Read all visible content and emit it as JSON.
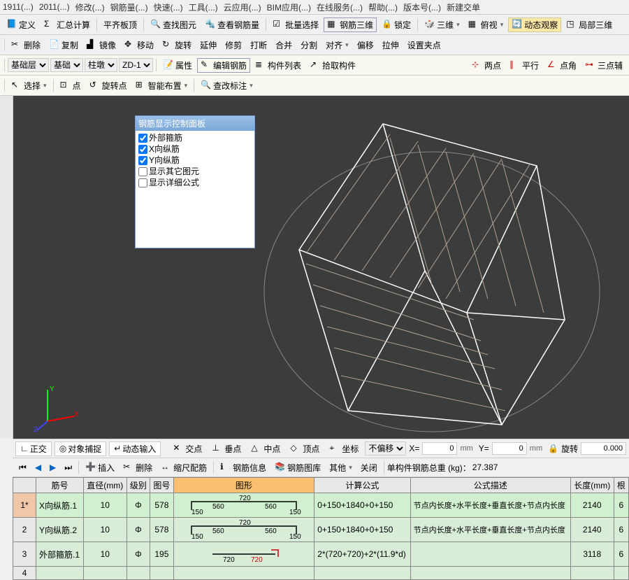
{
  "menubar": [
    "1911(...)",
    "2011(...)",
    "修改(...)",
    "钢筋量(...)",
    "快速(...)",
    "工具(...)",
    "云应用(...)",
    "BIM应用(...)",
    "在线服务(...)",
    "帮助(...)",
    "版本号(...)",
    "新建交单"
  ],
  "toolbar1": {
    "items": [
      "定义",
      "汇总计算",
      "平齐板顶",
      "查找图元",
      "查看钢筋量",
      "批量选择",
      "钢筋三维",
      "锁定"
    ],
    "group_3d": "三维",
    "view_top": "俯视",
    "dyn_view": "动态观察",
    "local_3d": "局部三维"
  },
  "toolbar2": {
    "items": [
      "删除",
      "复制",
      "镜像",
      "移动",
      "旋转",
      "延伸",
      "修剪",
      "打断",
      "合并",
      "分割",
      "对齐",
      "偏移",
      "拉伸",
      "设置夹点"
    ]
  },
  "toolbar3": {
    "layer_sel": "基础层",
    "categ_sel": "基础",
    "type_sel": "柱墩",
    "name_sel": "ZD-1",
    "attr": "属性",
    "edit_rebar": "编辑钢筋",
    "list": "构件列表",
    "pick": "拾取构件",
    "two_pt": "两点",
    "parallel": "平行",
    "pt_angle": "点角",
    "three_pt": "三点辅"
  },
  "toolbar4": {
    "select": "选择",
    "pt": "点",
    "rot_pt": "旋转点",
    "smart": "智能布置",
    "find_mark": "查改标注"
  },
  "panel": {
    "title": "钢筋显示控制面板",
    "items": [
      {
        "label": "外部箍筋",
        "checked": true
      },
      {
        "label": "X向纵筋",
        "checked": true
      },
      {
        "label": "Y向纵筋",
        "checked": true
      },
      {
        "label": "显示其它图元",
        "checked": false
      },
      {
        "label": "显示详细公式",
        "checked": false
      }
    ]
  },
  "status": {
    "ortho": "正交",
    "snap": "对象捕捉",
    "dynin": "动态输入",
    "cross": "交点",
    "perp": "垂点",
    "mid": "中点",
    "peak": "顶点",
    "coord": "坐标",
    "offset_sel": "不偏移",
    "x_label": "X=",
    "x_val": "0",
    "y_label": "Y=",
    "y_val": "0",
    "mm": "mm",
    "rotate": "旋转",
    "rot_val": "0.000"
  },
  "subtool": {
    "insert": "插入",
    "delete": "删除",
    "scale": "缩尺配筋",
    "info": "钢筋信息",
    "lib": "钢筋图库",
    "other": "其他",
    "close": "关闭",
    "weight_label": "单构件钢筋总重 (kg)：",
    "weight_val": "27.387"
  },
  "table": {
    "headers": [
      "",
      "筋号",
      "直径(mm)",
      "级别",
      "图号",
      "图形",
      "计算公式",
      "公式描述",
      "长度(mm)",
      "根"
    ],
    "rows": [
      {
        "n": "1*",
        "name": "X向纵筋.1",
        "dia": "10",
        "grade": "Φ",
        "code": "578",
        "shape": {
          "dims": [
            "150",
            "560",
            "720",
            "560",
            "150"
          ]
        },
        "formula": "0+150+1840+0+150",
        "desc": "节点内长度+水平长度+垂直长度+节点内长度",
        "len": "2140",
        "cnt": "6",
        "sel": true
      },
      {
        "n": "2",
        "name": "Y向纵筋.2",
        "dia": "10",
        "grade": "Φ",
        "code": "578",
        "shape": {
          "dims": [
            "150",
            "560",
            "720",
            "560",
            "150"
          ]
        },
        "formula": "0+150+1840+0+150",
        "desc": "节点内长度+水平长度+垂直长度+节点内长度",
        "len": "2140",
        "cnt": "6"
      },
      {
        "n": "3",
        "name": "外部箍筋.1",
        "dia": "10",
        "grade": "Φ",
        "code": "195",
        "shape": {
          "dims": [
            "720",
            "720"
          ]
        },
        "formula": "2*(720+720)+2*(11.9*d)",
        "desc": "",
        "len": "3118",
        "cnt": "6"
      },
      {
        "n": "4",
        "name": "",
        "dia": "",
        "grade": "",
        "code": "",
        "shape": null,
        "formula": "",
        "desc": "",
        "len": "",
        "cnt": ""
      }
    ]
  }
}
